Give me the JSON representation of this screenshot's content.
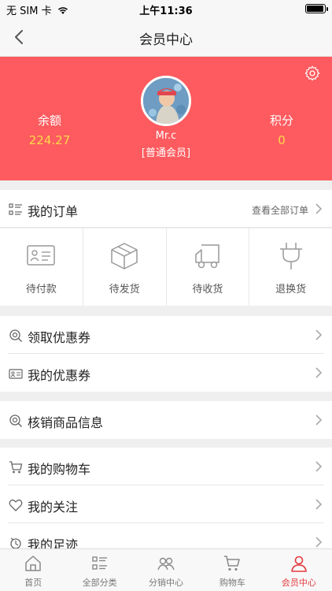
{
  "status_bar": {
    "carrier": "无 SIM 卡",
    "time": "上午11:36"
  },
  "nav": {
    "title": "会员中心"
  },
  "profile": {
    "balance_label": "余额",
    "balance_value": "224.27",
    "points_label": "积分",
    "points_value": "0",
    "username": "Mr.c",
    "level": "[普通会员]"
  },
  "orders": {
    "title": "我的订单",
    "view_all": "查看全部订单",
    "items": [
      {
        "label": "待付款",
        "icon": "card-icon"
      },
      {
        "label": "待发货",
        "icon": "box-icon"
      },
      {
        "label": "待收货",
        "icon": "truck-icon"
      },
      {
        "label": "退换货",
        "icon": "plug-icon"
      }
    ]
  },
  "menu": [
    {
      "label": "领取优惠券",
      "icon": "coupon-search-icon"
    },
    {
      "label": "我的优惠券",
      "icon": "coupon-card-icon"
    },
    {
      "label": "核销商品信息",
      "icon": "verify-search-icon"
    },
    {
      "label": "我的购物车",
      "icon": "cart-icon"
    },
    {
      "label": "我的关注",
      "icon": "heart-icon"
    },
    {
      "label": "我的足迹",
      "icon": "footprint-icon"
    }
  ],
  "tabs": [
    {
      "label": "首页",
      "icon": "home-icon"
    },
    {
      "label": "全部分类",
      "icon": "category-icon"
    },
    {
      "label": "分销中心",
      "icon": "distribution-icon"
    },
    {
      "label": "购物车",
      "icon": "cart-icon"
    },
    {
      "label": "会员中心",
      "icon": "user-icon",
      "active": true
    }
  ],
  "colors": {
    "header_bg": "#fd5b5f",
    "accent_yellow": "#ffd84a",
    "active_tab": "#e4393c"
  }
}
